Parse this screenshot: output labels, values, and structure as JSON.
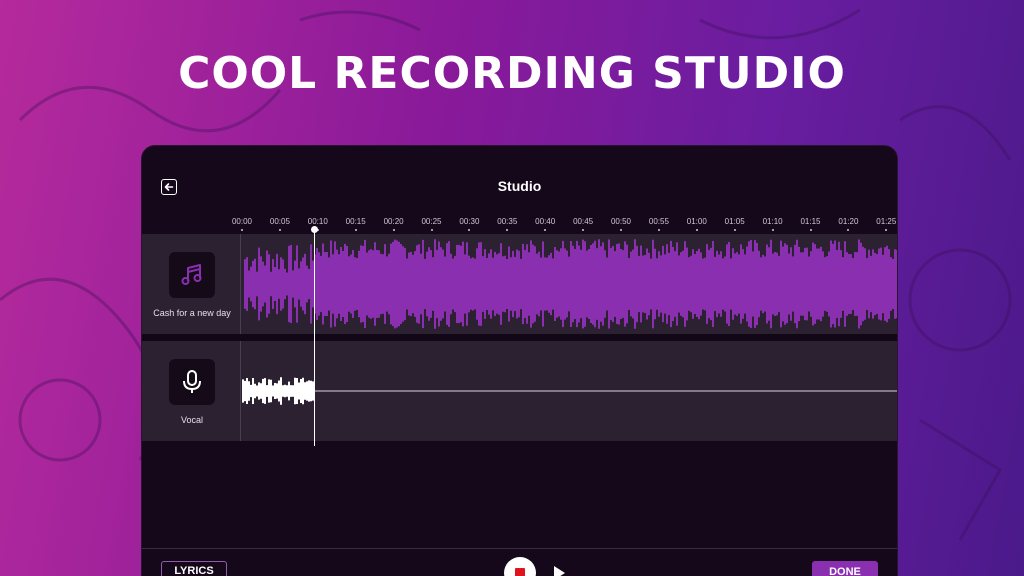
{
  "headline": "COOL RECORDING STUDIO",
  "header": {
    "title": "Studio",
    "back_icon": "back-arrow-icon"
  },
  "timeline": {
    "ticks": [
      "00:00",
      "00:05",
      "00:10",
      "00:15",
      "00:20",
      "00:25",
      "00:30",
      "00:35",
      "00:40",
      "00:45",
      "00:50",
      "00:55",
      "01:00",
      "01:05",
      "01:10",
      "01:15",
      "01:20",
      "01:25"
    ],
    "playhead_time": "00:10"
  },
  "tracks": [
    {
      "name": "Cash for a new day",
      "icon": "music-note-icon",
      "wave_color": "#8a2fb0"
    },
    {
      "name": "Vocal",
      "icon": "microphone-icon",
      "wave_color": "#ffffff"
    }
  ],
  "footer": {
    "lyrics_label": "LYRICS",
    "done_label": "DONE"
  },
  "colors": {
    "accent": "#8a2fb0",
    "record": "#e0141c",
    "panel": "#15081a",
    "track_bg": "#2b2131"
  }
}
